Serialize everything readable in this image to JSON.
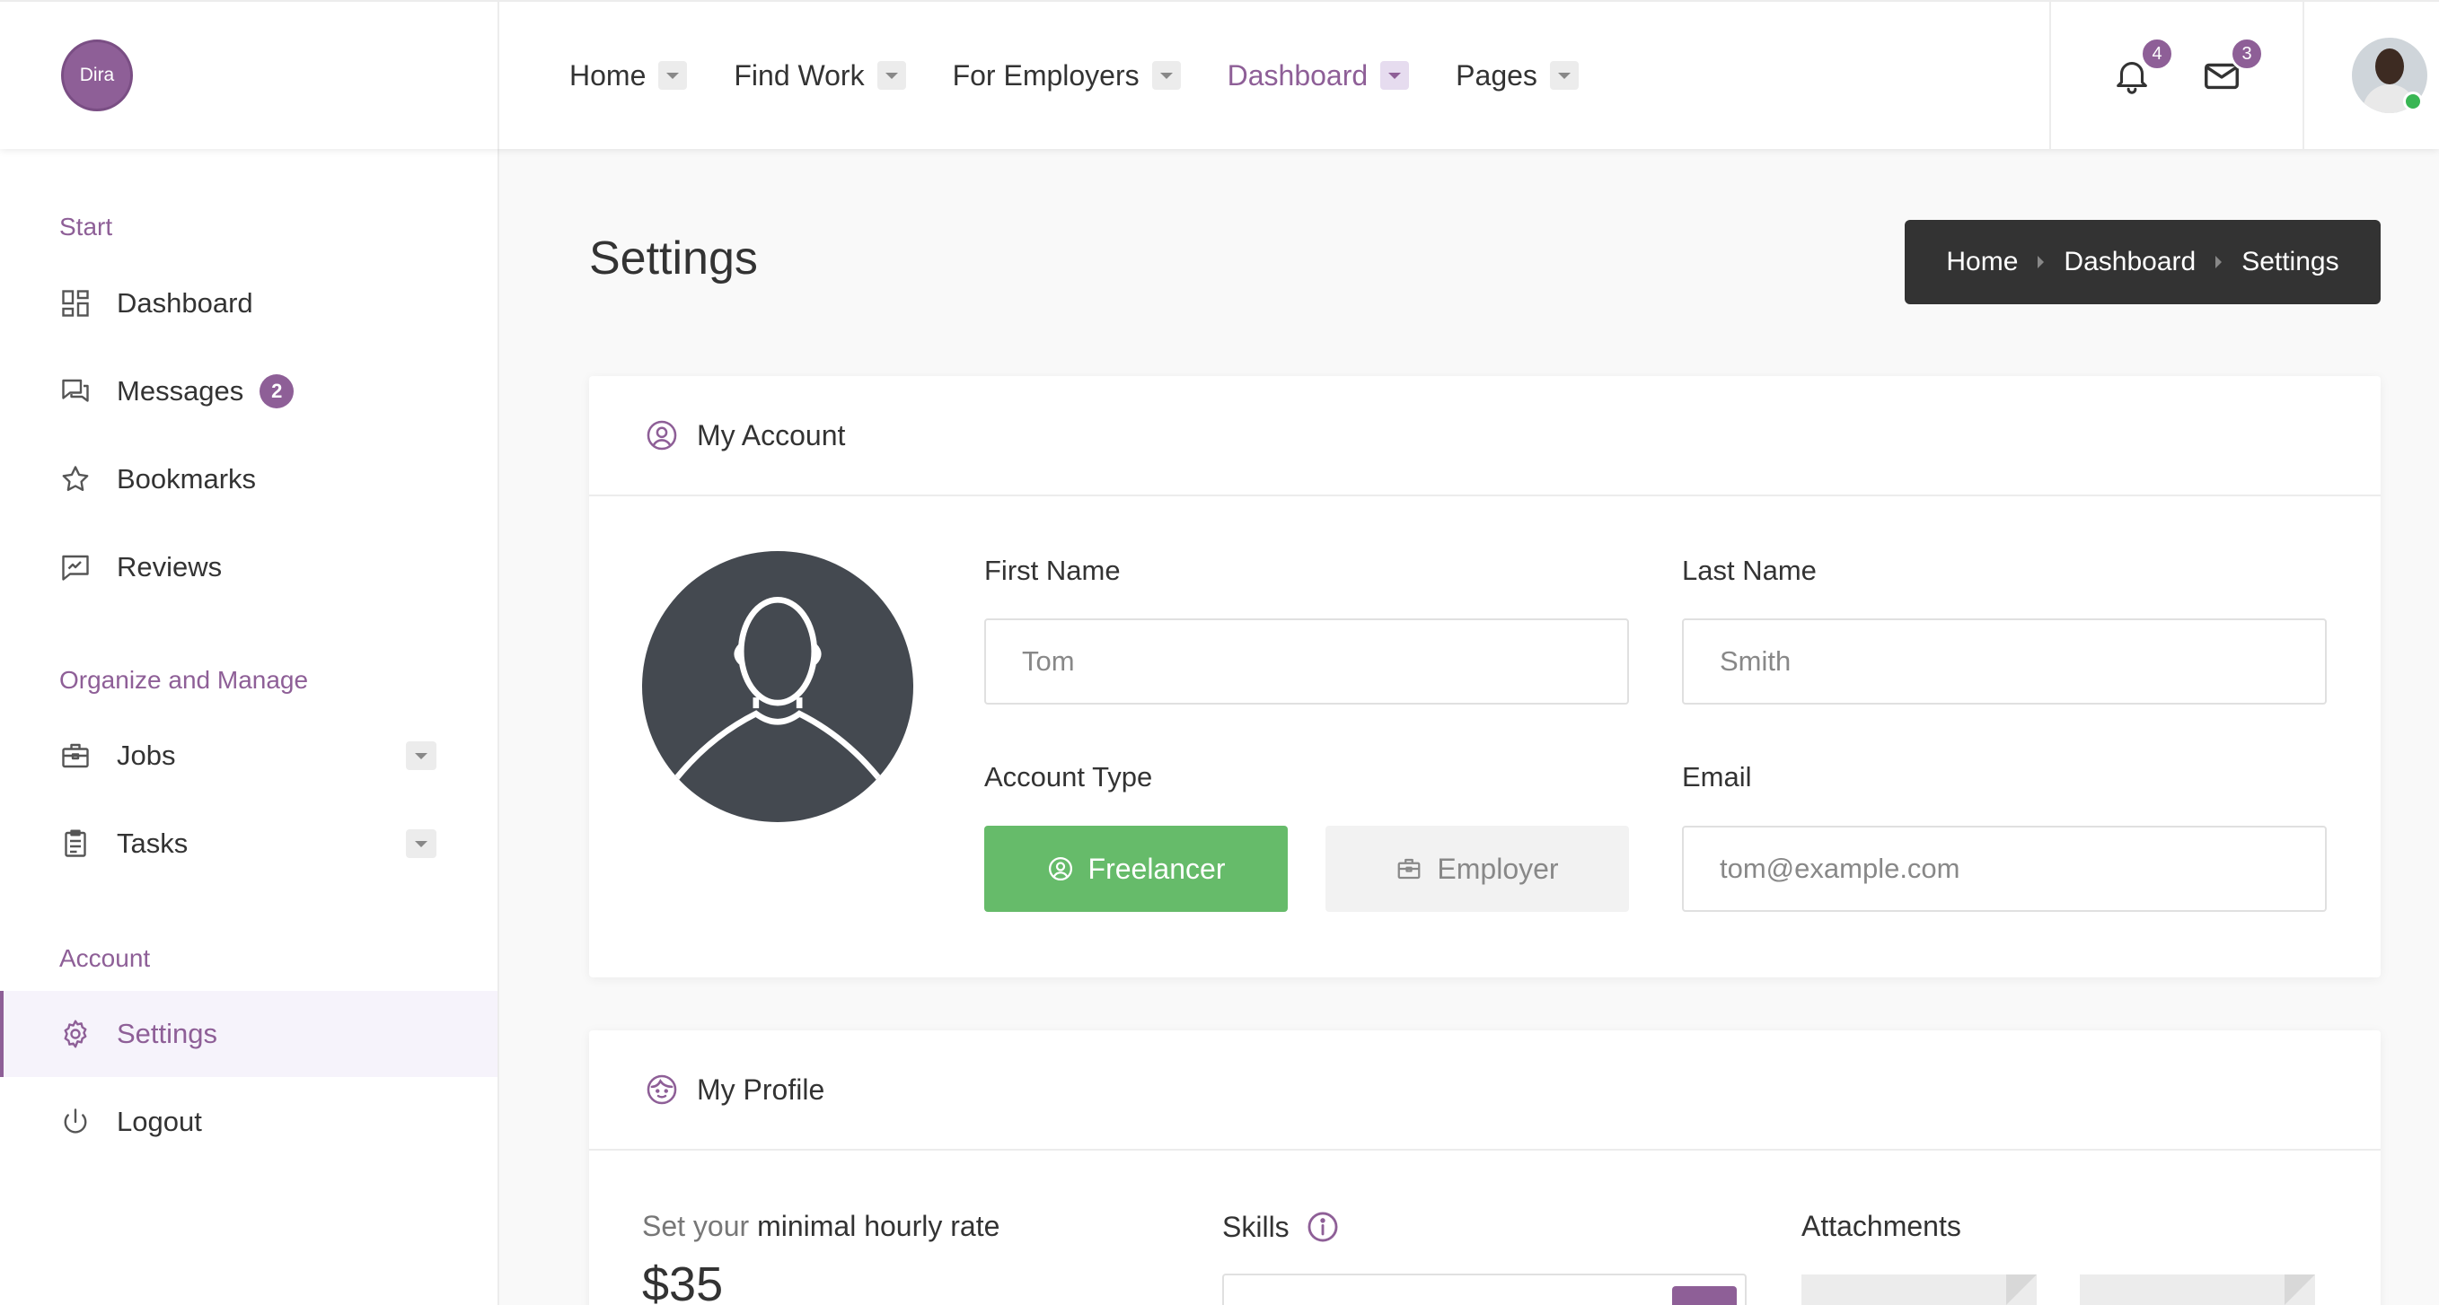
{
  "header": {
    "logo_text": "Dira",
    "nav": [
      {
        "label": "Home",
        "active": false
      },
      {
        "label": "Find Work",
        "active": false
      },
      {
        "label": "For Employers",
        "active": false
      },
      {
        "label": "Dashboard",
        "active": true
      },
      {
        "label": "Pages",
        "active": false
      }
    ],
    "notifications_count": "4",
    "messages_count": "3",
    "user_status": "online"
  },
  "sidebar": {
    "sections": [
      {
        "title": "Start"
      },
      {
        "title": "Organize and Manage"
      },
      {
        "title": "Account"
      }
    ],
    "items": [
      {
        "label": "Dashboard",
        "icon": "dashboard-icon"
      },
      {
        "label": "Messages",
        "icon": "chat-bubbles-icon",
        "badge": "2"
      },
      {
        "label": "Bookmarks",
        "icon": "star-icon"
      },
      {
        "label": "Reviews",
        "icon": "rating-icon"
      },
      {
        "label": "Jobs",
        "icon": "briefcase-icon",
        "expandable": true
      },
      {
        "label": "Tasks",
        "icon": "clipboard-icon",
        "expandable": true
      },
      {
        "label": "Settings",
        "icon": "gear-icon",
        "active": true
      },
      {
        "label": "Logout",
        "icon": "power-icon"
      }
    ]
  },
  "page": {
    "title": "Settings",
    "breadcrumb": [
      "Home",
      "Dashboard",
      "Settings"
    ]
  },
  "account_card": {
    "title": "My Account",
    "first_name_label": "First Name",
    "first_name_placeholder": "Tom",
    "last_name_label": "Last Name",
    "last_name_placeholder": "Smith",
    "account_type_label": "Account Type",
    "freelancer_label": "Freelancer",
    "employer_label": "Employer",
    "selected_account_type": "Freelancer",
    "email_label": "Email",
    "email_placeholder": "tom@example.com"
  },
  "profile_card": {
    "title": "My Profile",
    "rate_prefix": "Set your",
    "rate_emphasis": "minimal hourly rate",
    "rate_value": "$35",
    "skills_label": "Skills",
    "attachments_label": "Attachments"
  },
  "colors": {
    "accent": "#8e5f97",
    "freelancer_button": "#66bb6a",
    "breadcrumb_bg": "#333333",
    "online": "#38b653"
  }
}
